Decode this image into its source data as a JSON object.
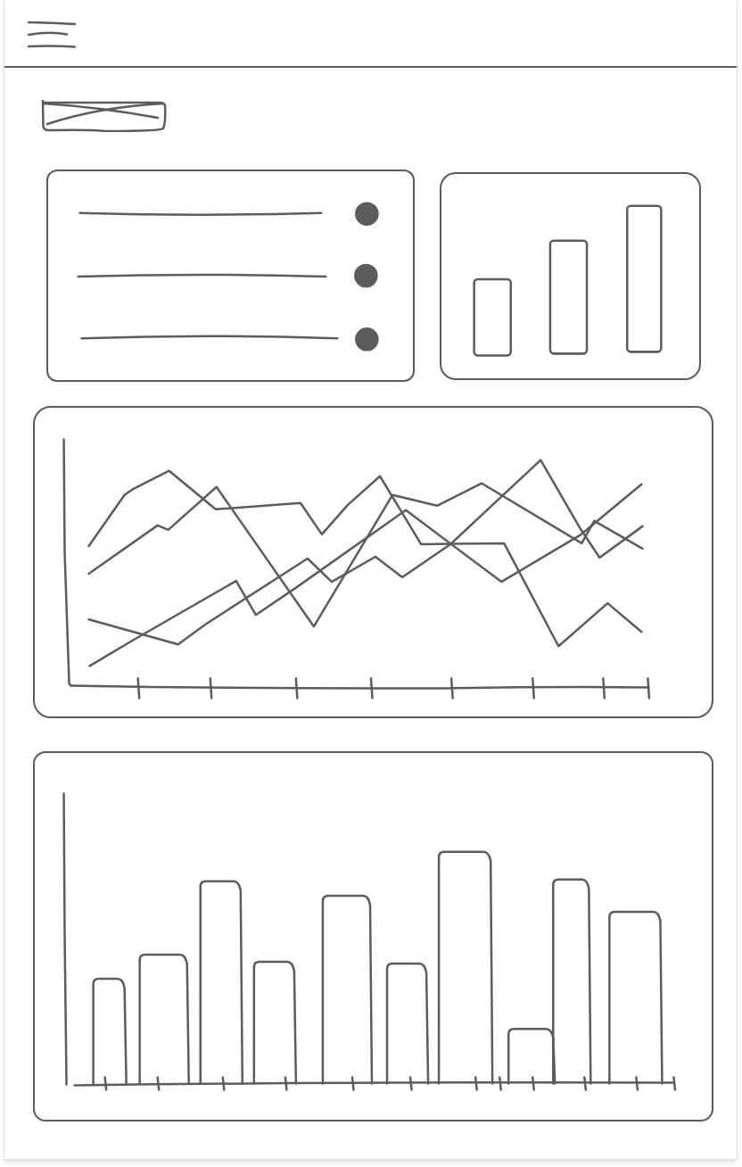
{
  "top_bar": {
    "menu_button": true
  },
  "image_placeholder": true,
  "cards": [
    {
      "kind": "list"
    },
    {
      "kind": "minibars"
    },
    {
      "kind": "lines"
    },
    {
      "kind": "bars"
    }
  ]
}
